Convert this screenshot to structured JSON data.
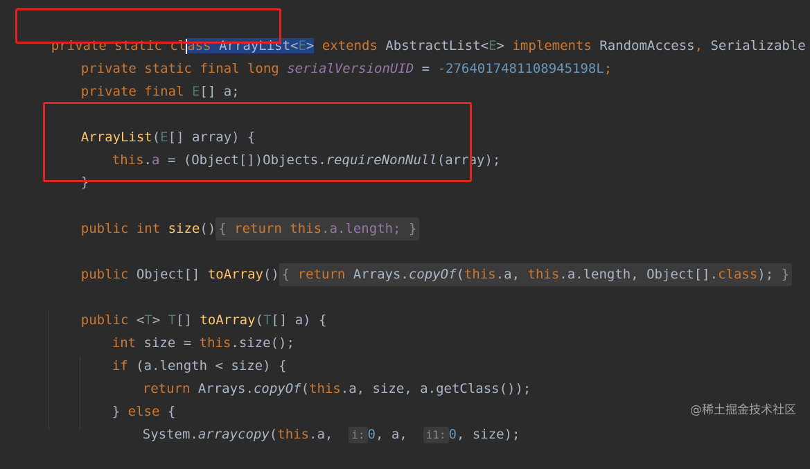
{
  "code": {
    "line1": {
      "private": "private",
      "static": "static",
      "cl": "cl",
      "ass": "ass",
      "name": "ArrayList",
      "lt": "<",
      "tparam": "E",
      "gt": ">",
      "extends": "extends",
      "super": "AbstractList<",
      "stparam": "E",
      "sgt": ">",
      "implements": "implements",
      "iface1": "RandomAccess",
      "comma": ",",
      "iface2": "Serializable {"
    },
    "line2": {
      "mods": "private static final long",
      "name": "serialVersionUID",
      "eq": " = ",
      "value": "-2764017481108945198L",
      "semi": ";"
    },
    "line3": {
      "mods": "private final",
      "type": "E",
      "rest": "[] a;"
    },
    "line4": {
      "name": "ArrayList",
      "open": "(",
      "tparam": "E",
      "rest": "[] array) {"
    },
    "line5": {
      "this": "this",
      "dot": ".",
      "field": "a",
      "eq": " = (Object[])Objects.",
      "method": "requireNonNull",
      "rest": "(array);"
    },
    "line6": {
      "text": "}"
    },
    "line7": {
      "kw": "public int",
      "name": "size",
      "parens": "()",
      "fold_open": "{",
      "fold_return": "return",
      "fold_this": "this",
      "fold_dot": ".",
      "fold_a": "a",
      "fold_dot2": ".",
      "fold_length": "length;",
      "fold_close": "}"
    },
    "line8": {
      "kw": "public",
      "type": "Object[]",
      "name": "toArray",
      "parens": "()",
      "fold_open": "{",
      "ret": "return",
      "cls": "Arrays.",
      "method": "copyOf",
      "args1": "(",
      "this1": "this",
      "a1": ".a, ",
      "this2": "this",
      "a2": ".a.length, ",
      "objarr": "Object[].",
      "classkw": "class",
      "end": ");",
      "fold_close": "}"
    },
    "line9": {
      "kw": "public",
      "lt": "<",
      "tparam": "T",
      "gt": "> ",
      "rtype": "T",
      "rtype_rest": "[] ",
      "name": "toArray",
      "open": "(",
      "ptype": "T",
      "rest": "[] a) {"
    },
    "line10": {
      "kw": "int",
      "rest1": " size = ",
      "this": "this",
      "rest2": ".size();"
    },
    "line11": {
      "kw": "if",
      "rest": " (a.length < size) {"
    },
    "line12": {
      "kw": "return",
      "cls": "Arrays.",
      "method": "copyOf",
      "open": "(",
      "this": "this",
      "rest": ".a, size, a.getClass());"
    },
    "line13": {
      "close": "} ",
      "kw": "else",
      "rest": " {"
    },
    "line14": {
      "cls": "System.",
      "method": "arraycopy",
      "open": "(",
      "this": "this",
      "a": ".a, ",
      "hint1": "i:",
      "zero1": "0",
      "mid": ", a, ",
      "hint2": "i1:",
      "zero2": "0",
      "rest": ", size);"
    }
  },
  "watermark": "@稀土掘金技术社区",
  "colors": {
    "background": "#2b2b2b",
    "keyword": "#cc7832",
    "function": "#ffc66d",
    "number": "#6897bb",
    "field": "#9876aa",
    "highlight_box": "#e02424"
  }
}
